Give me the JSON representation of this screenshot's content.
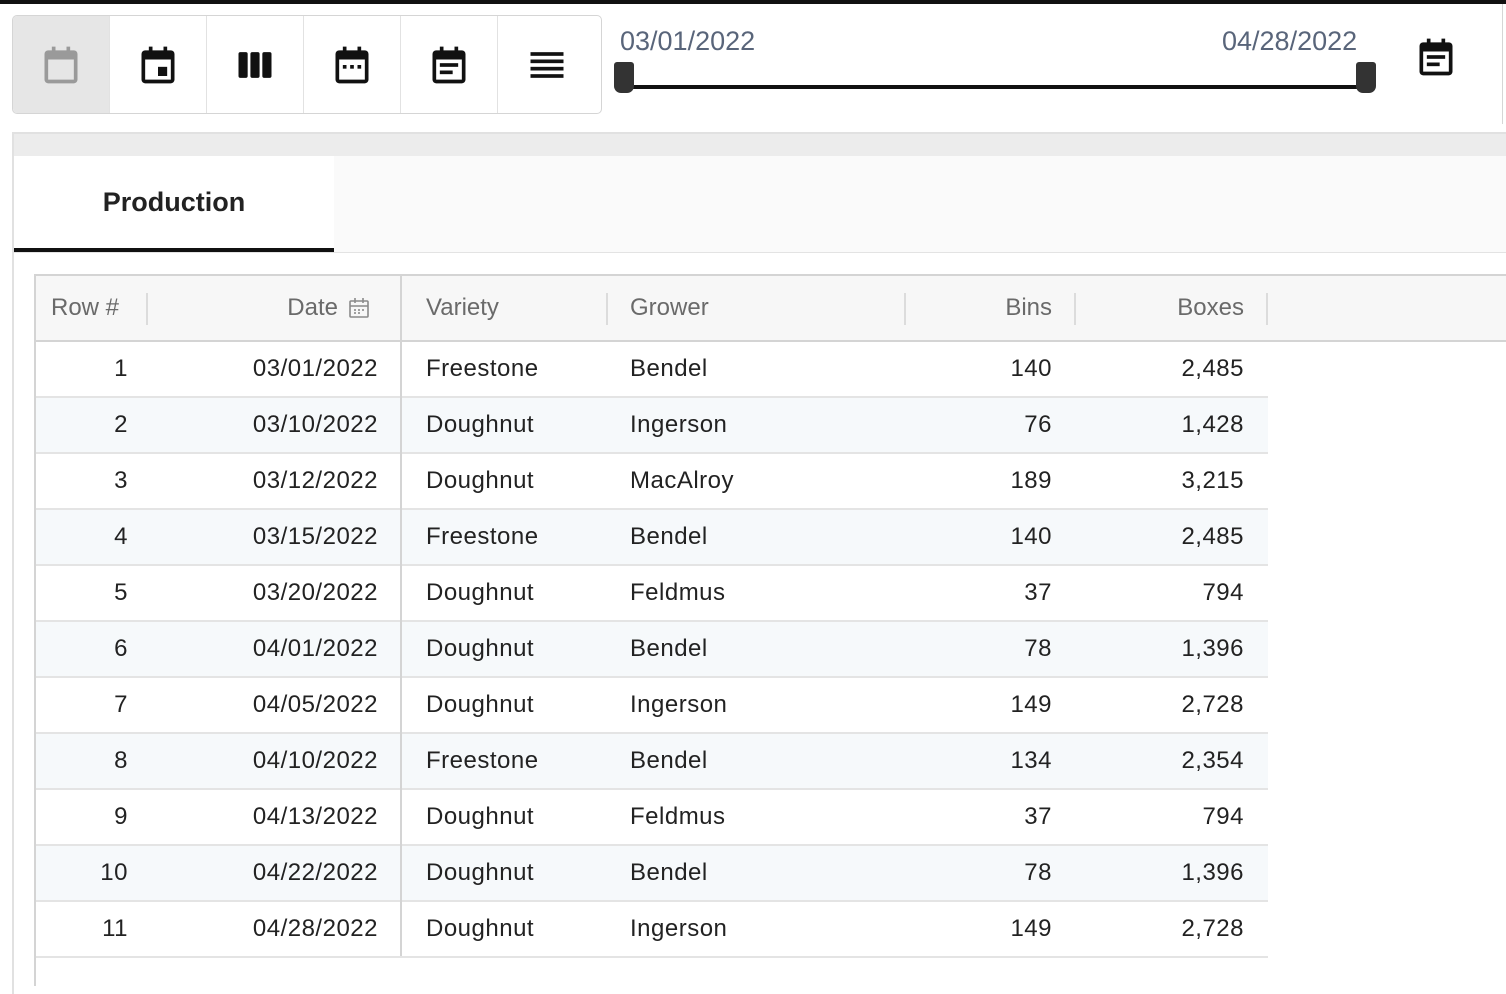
{
  "toolbar": {
    "views": [
      {
        "icon": "calendar-blank-icon",
        "active": true
      },
      {
        "icon": "calendar-day-icon",
        "active": false
      },
      {
        "icon": "view-columns-icon",
        "active": false
      },
      {
        "icon": "calendar-month-icon",
        "active": false
      },
      {
        "icon": "calendar-agenda-icon",
        "active": false
      },
      {
        "icon": "list-lines-icon",
        "active": false
      }
    ]
  },
  "date_range": {
    "start": "03/01/2022",
    "end": "04/28/2022"
  },
  "tabs": [
    {
      "label": "Production",
      "active": true
    }
  ],
  "grid": {
    "columns": {
      "row": "Row #",
      "date": "Date",
      "variety": "Variety",
      "grower": "Grower",
      "bins": "Bins",
      "boxes": "Boxes"
    },
    "rows": [
      {
        "row": "1",
        "date": "03/01/2022",
        "variety": "Freestone",
        "grower": "Bendel",
        "bins": "140",
        "boxes": "2,485"
      },
      {
        "row": "2",
        "date": "03/10/2022",
        "variety": "Doughnut",
        "grower": "Ingerson",
        "bins": "76",
        "boxes": "1,428"
      },
      {
        "row": "3",
        "date": "03/12/2022",
        "variety": "Doughnut",
        "grower": "MacAlroy",
        "bins": "189",
        "boxes": "3,215"
      },
      {
        "row": "4",
        "date": "03/15/2022",
        "variety": "Freestone",
        "grower": "Bendel",
        "bins": "140",
        "boxes": "2,485"
      },
      {
        "row": "5",
        "date": "03/20/2022",
        "variety": "Doughnut",
        "grower": "Feldmus",
        "bins": "37",
        "boxes": "794"
      },
      {
        "row": "6",
        "date": "04/01/2022",
        "variety": "Doughnut",
        "grower": "Bendel",
        "bins": "78",
        "boxes": "1,396"
      },
      {
        "row": "7",
        "date": "04/05/2022",
        "variety": "Doughnut",
        "grower": "Ingerson",
        "bins": "149",
        "boxes": "2,728"
      },
      {
        "row": "8",
        "date": "04/10/2022",
        "variety": "Freestone",
        "grower": "Bendel",
        "bins": "134",
        "boxes": "2,354"
      },
      {
        "row": "9",
        "date": "04/13/2022",
        "variety": "Doughnut",
        "grower": "Feldmus",
        "bins": "37",
        "boxes": "794"
      },
      {
        "row": "10",
        "date": "04/22/2022",
        "variety": "Doughnut",
        "grower": "Bendel",
        "bins": "78",
        "boxes": "1,396"
      },
      {
        "row": "11",
        "date": "04/28/2022",
        "variety": "Doughnut",
        "grower": "Ingerson",
        "bins": "149",
        "boxes": "2,728"
      }
    ]
  }
}
